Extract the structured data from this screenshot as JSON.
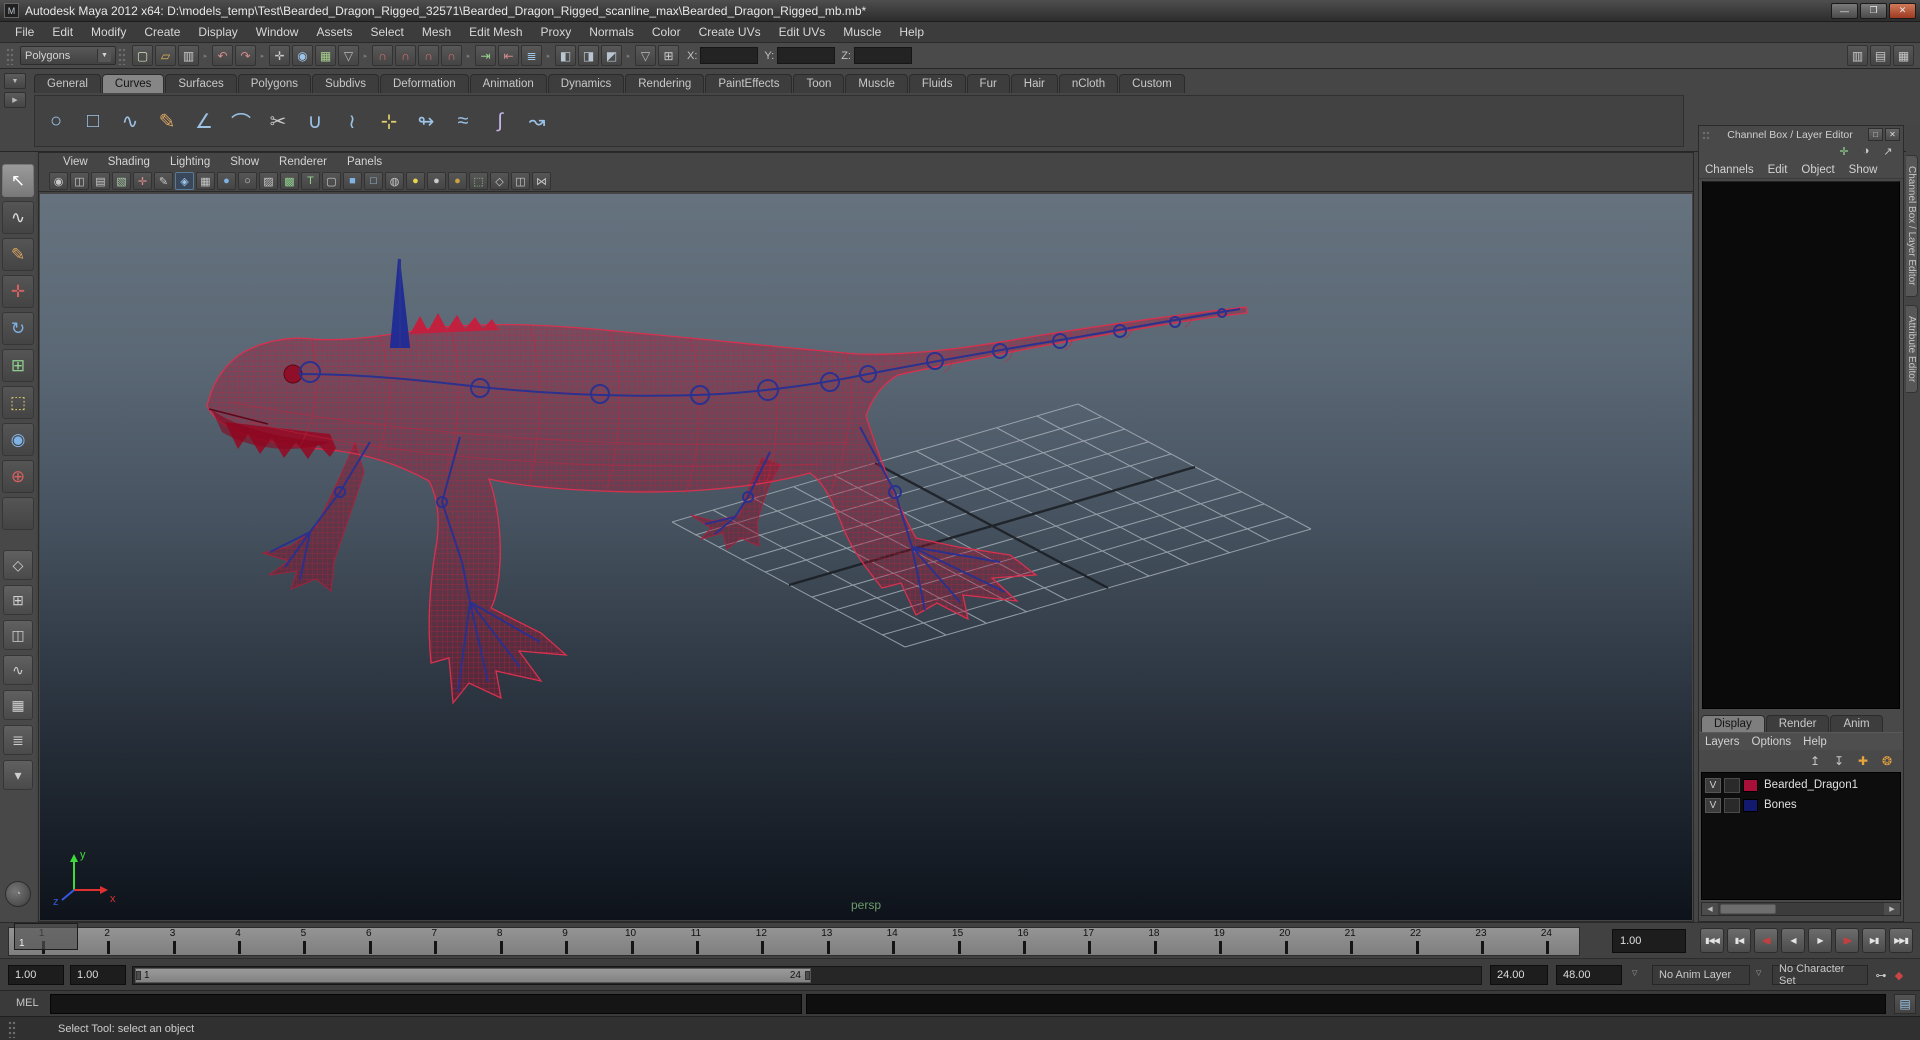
{
  "window": {
    "title": "Autodesk Maya 2012 x64: D:\\models_temp\\Test\\Bearded_Dragon_Rigged_32571\\Bearded_Dragon_Rigged_scanline_max\\Bearded_Dragon_Rigged_mb.mb*",
    "app_icon_glyph": "M",
    "minimize": "—",
    "maximize": "❐",
    "close": "✕"
  },
  "menu_bar": {
    "items": [
      "File",
      "Edit",
      "Modify",
      "Create",
      "Display",
      "Window",
      "Assets",
      "Select",
      "Mesh",
      "Edit Mesh",
      "Proxy",
      "Normals",
      "Color",
      "Create UVs",
      "Edit UVs",
      "Muscle",
      "Help"
    ]
  },
  "status_line": {
    "mode_selector": "Polygons",
    "icons": [
      {
        "name": "file-new-icon",
        "glyph": "▢",
        "color": "#cfe3b8"
      },
      {
        "name": "file-open-icon",
        "glyph": "▱",
        "color": "#ddb457"
      },
      {
        "name": "file-save-icon",
        "glyph": "▥",
        "color": "#cccccc"
      },
      {
        "name": "group-separator",
        "glyph": "▸",
        "sep": true
      },
      {
        "name": "undo-icon",
        "glyph": "↶",
        "color": "#d98c8c"
      },
      {
        "name": "redo-icon",
        "glyph": "↷",
        "color": "#d98c8c"
      },
      {
        "name": "group-separator",
        "glyph": "▸",
        "sep": true
      },
      {
        "name": "select-hierarchy-icon",
        "glyph": "✛",
        "color": "#cccccc"
      },
      {
        "name": "select-object-icon",
        "glyph": "◉",
        "color": "#9ec6e8",
        "active_btn": true
      },
      {
        "name": "select-component-icon",
        "glyph": "▦",
        "color": "#a9d18e"
      },
      {
        "name": "selection-mask-dropdown",
        "glyph": "▽",
        "color": "#bbbbbb"
      },
      {
        "name": "group-separator",
        "glyph": "▸",
        "sep": true
      },
      {
        "name": "snap-grid-icon",
        "glyph": "∩",
        "color": "#e07070"
      },
      {
        "name": "snap-curve-icon",
        "glyph": "∩",
        "color": "#e07070"
      },
      {
        "name": "snap-point-icon",
        "glyph": "∩",
        "color": "#e07070"
      },
      {
        "name": "snap-plane-icon",
        "glyph": "∩",
        "color": "#e07070"
      },
      {
        "name": "group-separator",
        "glyph": "▸",
        "sep": true
      },
      {
        "name": "input-connections-icon",
        "glyph": "⇥",
        "color": "#96d38c"
      },
      {
        "name": "output-connections-icon",
        "glyph": "⇤",
        "color": "#d38c8c"
      },
      {
        "name": "construction-history-icon",
        "glyph": "≣",
        "color": "#9ec6e8"
      },
      {
        "name": "group-separator",
        "glyph": "▸",
        "sep": true
      },
      {
        "name": "render-current-frame-icon",
        "glyph": "◧",
        "color": "#b9c6d2"
      },
      {
        "name": "ipr-render-icon",
        "glyph": "◨",
        "color": "#b9c6d2"
      },
      {
        "name": "render-settings-icon",
        "glyph": "◩",
        "color": "#b9c6d2"
      },
      {
        "name": "group-separator",
        "glyph": "▸",
        "sep": true
      },
      {
        "name": "snap-align-dropdown",
        "glyph": "▽",
        "color": "#bbbbbb"
      },
      {
        "name": "symmetry-icon",
        "glyph": "⊞",
        "color": "#cccccc"
      }
    ],
    "coord_fields": [
      {
        "label": "X:",
        "value": ""
      },
      {
        "label": "Y:",
        "value": ""
      },
      {
        "label": "Z:",
        "value": ""
      }
    ],
    "right_icons": [
      {
        "name": "attribute-editor-toggle-icon",
        "glyph": "▥",
        "color": "#c9c9c9"
      },
      {
        "name": "tool-settings-toggle-icon",
        "glyph": "▤",
        "color": "#c9c9c9"
      },
      {
        "name": "channel-box-toggle-icon",
        "glyph": "▦",
        "color": "#c9c9c9"
      }
    ]
  },
  "shelf": {
    "mini_buttons": [
      {
        "name": "shelf-menu-button",
        "glyph": "▼"
      },
      {
        "name": "shelf-tab-button",
        "glyph": "▶"
      }
    ],
    "tabs": [
      {
        "label": "General"
      },
      {
        "label": "Curves",
        "active": true
      },
      {
        "label": "Surfaces"
      },
      {
        "label": "Polygons"
      },
      {
        "label": "Subdivs"
      },
      {
        "label": "Deformation"
      },
      {
        "label": "Animation"
      },
      {
        "label": "Dynamics"
      },
      {
        "label": "Rendering"
      },
      {
        "label": "PaintEffects"
      },
      {
        "label": "Toon"
      },
      {
        "label": "Muscle"
      },
      {
        "label": "Fluids"
      },
      {
        "label": "Fur"
      },
      {
        "label": "Hair"
      },
      {
        "label": "nCloth"
      },
      {
        "label": "Custom"
      }
    ],
    "items": [
      {
        "name": "nurbs-circle-icon",
        "glyph": "○",
        "color": "#9cc3e6"
      },
      {
        "name": "nurbs-square-icon",
        "glyph": "□",
        "color": "#9cc3e6"
      },
      {
        "name": "cv-curve-tool-icon",
        "glyph": "∿",
        "color": "#9cc3e6"
      },
      {
        "name": "pencil-curve-tool-icon",
        "glyph": "✎",
        "color": "#d9a560"
      },
      {
        "name": "ep-curve-tool-icon",
        "glyph": "∠",
        "color": "#9cc3e6"
      },
      {
        "name": "attach-curves-icon",
        "glyph": "⌒",
        "color": "#9cc3e6"
      },
      {
        "name": "detach-curves-icon",
        "glyph": "✂",
        "color": "#c9c9c9"
      },
      {
        "name": "open-close-curve-icon",
        "glyph": "∪",
        "color": "#9cc3e6"
      },
      {
        "name": "curve-fillet-icon",
        "glyph": "≀",
        "color": "#9cc3e6"
      },
      {
        "name": "insert-knot-icon",
        "glyph": "⊹",
        "color": "#e3d26a"
      },
      {
        "name": "extend-curve-icon",
        "glyph": "↬",
        "color": "#9cc3e6"
      },
      {
        "name": "offset-curve-icon",
        "glyph": "≈",
        "color": "#9cc3e6"
      },
      {
        "name": "rebuild-curve-icon",
        "glyph": "∫",
        "color": "#c9b3e6"
      },
      {
        "name": "project-curve-icon",
        "glyph": "↝",
        "color": "#9cc3e6"
      }
    ]
  },
  "toolbox": {
    "tools": [
      {
        "name": "select-tool",
        "glyph": "↖",
        "color": "#ffffff",
        "active": true
      },
      {
        "name": "lasso-select-tool",
        "glyph": "∿",
        "color": "#e0e0e0"
      },
      {
        "name": "paint-selection-tool",
        "glyph": "✎",
        "color": "#d9a560"
      },
      {
        "name": "move-tool",
        "glyph": "✛",
        "color": "#d86060"
      },
      {
        "name": "rotate-tool",
        "glyph": "↻",
        "color": "#7fb2e5"
      },
      {
        "name": "scale-tool",
        "glyph": "⊞",
        "color": "#8fd08f"
      },
      {
        "name": "universal-manipulator-tool",
        "glyph": "⬚",
        "color": "#e3d26a"
      },
      {
        "name": "soft-modification-tool",
        "glyph": "◉",
        "color": "#7fb2e5"
      },
      {
        "name": "show-manipulator-tool",
        "glyph": "⊕",
        "color": "#d86060"
      },
      {
        "name": "last-tool-used",
        "glyph": "",
        "color": "#cccccc"
      }
    ],
    "layouts": [
      {
        "name": "layout-single-pane-button",
        "glyph": "◇"
      },
      {
        "name": "layout-four-pane-button",
        "glyph": "⊞"
      },
      {
        "name": "layout-persp-outliner-button",
        "glyph": "◫"
      },
      {
        "name": "layout-persp-graph-button",
        "glyph": "∿"
      },
      {
        "name": "layout-hypershade-button",
        "glyph": "▦"
      },
      {
        "name": "layout-persp-trax-button",
        "glyph": "≣"
      },
      {
        "name": "layout-more-dropdown",
        "glyph": "▾"
      }
    ],
    "extra_button_glyph": "◔"
  },
  "viewport": {
    "menus": [
      "View",
      "Shading",
      "Lighting",
      "Show",
      "Renderer",
      "Panels"
    ],
    "toolbar_icons": [
      {
        "name": "select-camera-icon",
        "glyph": "◉",
        "color": "#c9c9c9"
      },
      {
        "name": "camera-attributes-icon",
        "glyph": "◫",
        "color": "#c9c9c9"
      },
      {
        "name": "bookmarks-icon",
        "glyph": "▤",
        "color": "#c9c9c9"
      },
      {
        "name": "image-plane-icon",
        "glyph": "▧",
        "color": "#a9c9a9"
      },
      {
        "name": "2d-pan-zoom-icon",
        "glyph": "✛",
        "color": "#d98c8c"
      },
      {
        "name": "grease-pencil-icon",
        "glyph": "✎",
        "color": "#c9c9c9"
      },
      {
        "name": "wireframe-icon",
        "glyph": "◈",
        "color": "#9cc3e6",
        "active_btn": true
      },
      {
        "name": "film-gate-icon",
        "glyph": "▦",
        "color": "#c9c9c9"
      },
      {
        "name": "smooth-shade-icon",
        "glyph": "●",
        "color": "#7fb2e5"
      },
      {
        "name": "default-material-icon",
        "glyph": "○",
        "color": "#c9c9c9"
      },
      {
        "name": "no-texture-icon",
        "glyph": "▨",
        "color": "#c9c9c9"
      },
      {
        "name": "vertex-color-icon",
        "glyph": "▩",
        "color": "#8fd08f"
      },
      {
        "name": "textured-mode-icon",
        "glyph": "T",
        "color": "#8fd08f"
      },
      {
        "name": "isolate-select-icon",
        "glyph": "▢",
        "color": "#c9c9c9"
      },
      {
        "name": "xray-icon",
        "glyph": "■",
        "color": "#7fb2e5"
      },
      {
        "name": "xray-joints-icon",
        "glyph": "□",
        "color": "#9cc3e6"
      },
      {
        "name": "use-default-material-icon",
        "glyph": "◍",
        "color": "#c9c9c9"
      },
      {
        "name": "all-lights-icon",
        "glyph": "●",
        "color": "#e8d44d"
      },
      {
        "name": "default-light-icon",
        "glyph": "●",
        "color": "#c9c9c9"
      },
      {
        "name": "no-lights-icon",
        "glyph": "●",
        "color": "#c9a23d"
      },
      {
        "name": "object-selection-mode-icon",
        "glyph": "⬚",
        "color": "#8fd08f"
      },
      {
        "name": "panel-layout-icon",
        "glyph": "◇",
        "color": "#c9c9c9"
      },
      {
        "name": "panel-stack-icon",
        "glyph": "◫",
        "color": "#c9c9c9"
      },
      {
        "name": "share-view-icon",
        "glyph": "⋈",
        "color": "#c9c9c9"
      }
    ],
    "camera_label": "persp",
    "axis": {
      "x": "x",
      "y": "y",
      "z": "z"
    }
  },
  "channel_box": {
    "title": "Channel Box / Layer Editor",
    "header_buttons": [
      {
        "name": "panel-float-button",
        "glyph": "□"
      },
      {
        "name": "panel-close-button",
        "glyph": "✕"
      }
    ],
    "corner_icons": [
      {
        "name": "move-manipulator-speed-icon",
        "glyph": "✛",
        "color": "#8fd08f"
      },
      {
        "name": "speed-dial-icon",
        "glyph": "◑",
        "color": "#c9c9c9"
      },
      {
        "name": "hyperbolic-speed-icon",
        "glyph": "↗",
        "color": "#c9c9c9"
      }
    ],
    "menus": [
      "Channels",
      "Edit",
      "Object",
      "Show"
    ],
    "side_tabs": [
      {
        "label": "Channel Box / Layer Editor"
      },
      {
        "label": "Attribute Editor"
      }
    ]
  },
  "layer_editor": {
    "tabs": [
      {
        "label": "Display",
        "active": true
      },
      {
        "label": "Render"
      },
      {
        "label": "Anim"
      }
    ],
    "menus": [
      "Layers",
      "Options",
      "Help"
    ],
    "toolbar_icons": [
      {
        "name": "move-layer-up-icon",
        "glyph": "↥",
        "color": "#c9c9c9"
      },
      {
        "name": "move-layer-down-icon",
        "glyph": "↧",
        "color": "#c9c9c9"
      },
      {
        "name": "new-empty-layer-icon",
        "glyph": "✚",
        "color": "#e8a33d"
      },
      {
        "name": "new-layer-from-selected-icon",
        "glyph": "❂",
        "color": "#e8a33d"
      }
    ],
    "layers": [
      {
        "visibility": "V",
        "color": "#a8103a",
        "name": "Bearded_Dragon1"
      },
      {
        "visibility": "V",
        "color": "#121a6e",
        "name": "Bones"
      }
    ]
  },
  "time_slider": {
    "frames": [
      "1",
      "2",
      "3",
      "4",
      "5",
      "6",
      "7",
      "8",
      "9",
      "10",
      "11",
      "12",
      "13",
      "14",
      "15",
      "16",
      "17",
      "18",
      "19",
      "20",
      "21",
      "22",
      "23",
      "24"
    ],
    "current_frame": "1",
    "current_time": "1.00",
    "playback_buttons": [
      {
        "name": "go-to-start-button",
        "glyph": "▮◀◀"
      },
      {
        "name": "step-back-frame-button",
        "glyph": "▮◀"
      },
      {
        "name": "step-back-key-button",
        "glyph": "◀▮",
        "accent": "#c04040"
      },
      {
        "name": "play-backwards-button",
        "glyph": "◀"
      },
      {
        "name": "play-forwards-button",
        "glyph": "▶"
      },
      {
        "name": "step-forward-key-button",
        "glyph": "▮▶",
        "accent": "#c04040"
      },
      {
        "name": "step-forward-frame-button",
        "glyph": "▶▮"
      },
      {
        "name": "go-to-end-button",
        "glyph": "▶▶▮"
      }
    ]
  },
  "range_slider": {
    "anim_start": "1.00",
    "playback_start": "1.00",
    "range_start_label": "1",
    "range_end_label": "24",
    "playback_end": "24.00",
    "anim_end": "48.00",
    "anim_layer": "No Anim Layer",
    "character_set": "No Character Set",
    "key_icons": [
      {
        "name": "set-key-icon",
        "glyph": "⊶",
        "color": "#c9c9c9"
      },
      {
        "name": "auto-keyframe-icon",
        "glyph": "◆",
        "color": "#cc4444"
      }
    ]
  },
  "command_line": {
    "label": "MEL",
    "input_value": "",
    "script_editor_icon": "▤",
    "help_text": "Select Tool: select an object"
  },
  "colors": {
    "wireframe_red": "#c2203f",
    "bone_blue": "#283091",
    "layer_red": "#a8103a",
    "layer_blue": "#121a6e",
    "viewport_top": "#66737f",
    "viewport_bottom": "#0e131b",
    "persp_label": "#6c9a6c"
  }
}
